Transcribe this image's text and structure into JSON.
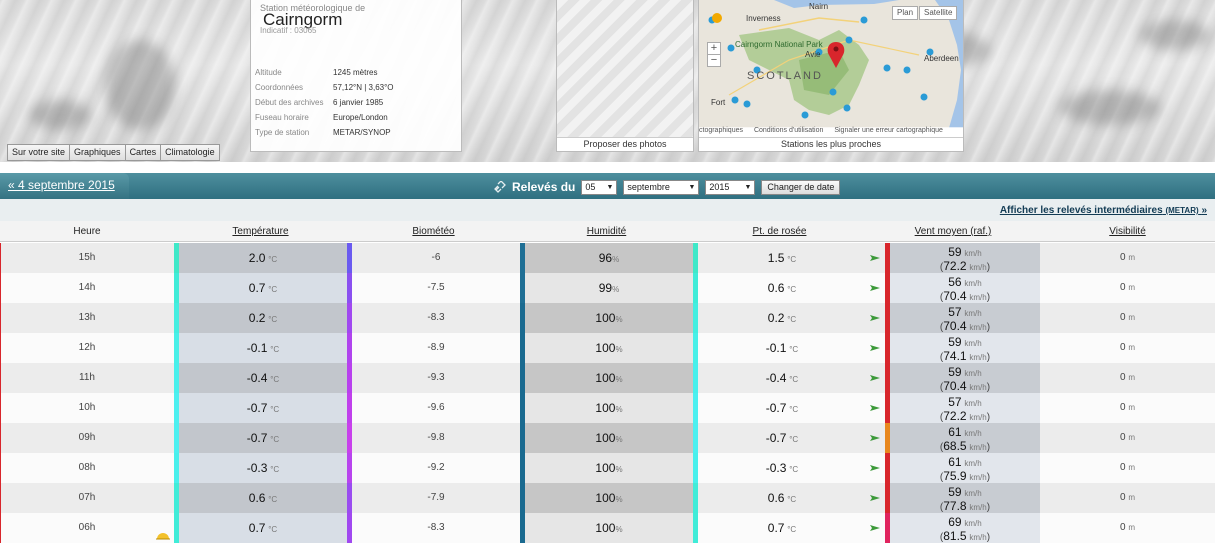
{
  "station": {
    "prefix": "Station météorologique de",
    "name": "Cairngorm",
    "indicatif": "Indicatif : 03065",
    "info": [
      {
        "label": "Altitude",
        "value": "1245 mètres"
      },
      {
        "label": "Coordonnées",
        "value": "57,12°N | 3,63°O"
      },
      {
        "label": "Début des archives",
        "value": "6 janvier 1985"
      },
      {
        "label": "Fuseau horaire",
        "value": "Europe/London"
      },
      {
        "label": "Type de station",
        "value": "METAR/SYNOP"
      }
    ]
  },
  "tabs": [
    "Sur votre site",
    "Graphiques",
    "Cartes",
    "Climatologie"
  ],
  "photos": {
    "caption": "Proposer des photos"
  },
  "map": {
    "caption": "Stations les plus proches",
    "btn_plan": "Plan",
    "btn_sat": "Satellite",
    "labels": [
      "Inverness",
      "Cairngorm National Park",
      "SCOTLAND",
      "Aberdeen",
      "Nairn",
      "Fort",
      "Avie"
    ],
    "attribution": [
      "ctographiques",
      "Conditions d'utilisation",
      "Signaler une erreur cartographique"
    ],
    "zoom_in": "+",
    "zoom_out": "−",
    "colors": {
      "land": "#e9e5dc",
      "park": "#a9c98c",
      "sea": "#a4c4e8",
      "marker": "#2a9bd6",
      "selected": "#d8262c"
    }
  },
  "nav": {
    "prev_day": "« 4 septembre 2015",
    "title": "Relevés du",
    "day": "05",
    "month": "septembre",
    "year": "2015",
    "change": "Changer de date",
    "show_intermediate": "Afficher les relevés intermédiaires",
    "metar_tag": "(METAR)",
    "arrow": "»"
  },
  "columns": [
    "Heure",
    "Température",
    "Biométéo",
    "Humidité",
    "Pt. de rosée",
    "Vent moyen (raf.)",
    "Visibilité"
  ],
  "units": {
    "temp": "°C",
    "hum": "%",
    "wind": "km/h",
    "vis": "m"
  },
  "rows": [
    {
      "hour": "15h",
      "temp": "2.0",
      "bio": "-6",
      "hum": "96",
      "dew": "1.5",
      "wind": "59",
      "gust": "72.2",
      "vis": "0",
      "c_temp": "#3fe8c8",
      "c_bio": "#6a5af0",
      "c_hum": "#1f6f95",
      "c_dew": "#3fe8c8",
      "c_wind": "#d8262c"
    },
    {
      "hour": "14h",
      "temp": "0.7",
      "bio": "-7.5",
      "hum": "99",
      "dew": "0.6",
      "wind": "56",
      "gust": "70.4",
      "vis": "0",
      "c_temp": "#40ecd8",
      "c_bio": "#8a50f0",
      "c_hum": "#1f6f95",
      "c_dew": "#40ecd8",
      "c_wind": "#d8262c"
    },
    {
      "hour": "13h",
      "temp": "0.2",
      "bio": "-8.3",
      "hum": "100",
      "dew": "0.2",
      "wind": "57",
      "gust": "70.4",
      "vis": "0",
      "c_temp": "#44eee0",
      "c_bio": "#a048f0",
      "c_hum": "#1a6a90",
      "c_dew": "#44eee0",
      "c_wind": "#d8262c"
    },
    {
      "hour": "12h",
      "temp": "-0.1",
      "bio": "-8.9",
      "hum": "100",
      "dew": "-0.1",
      "wind": "59",
      "gust": "74.1",
      "vis": "0",
      "c_temp": "#48f0e8",
      "c_bio": "#b044ee",
      "c_hum": "#1a6a90",
      "c_dew": "#48f0e8",
      "c_wind": "#d8262c"
    },
    {
      "hour": "11h",
      "temp": "-0.4",
      "bio": "-9.3",
      "hum": "100",
      "dew": "-0.4",
      "wind": "59",
      "gust": "70.4",
      "vis": "0",
      "c_temp": "#48f0ec",
      "c_bio": "#b840ee",
      "c_hum": "#1a6a90",
      "c_dew": "#48f0ec",
      "c_wind": "#d8262c"
    },
    {
      "hour": "10h",
      "temp": "-0.7",
      "bio": "-9.6",
      "hum": "100",
      "dew": "-0.7",
      "wind": "57",
      "gust": "72.2",
      "vis": "0",
      "c_temp": "#4cf0f0",
      "c_bio": "#c040ec",
      "c_hum": "#1a6a90",
      "c_dew": "#4cf0f0",
      "c_wind": "#d8262c"
    },
    {
      "hour": "09h",
      "temp": "-0.7",
      "bio": "-9.8",
      "hum": "100",
      "dew": "-0.7",
      "wind": "61",
      "gust": "68.5",
      "vis": "0",
      "c_temp": "#4cf0f0",
      "c_bio": "#c840ec",
      "c_hum": "#1a6a90",
      "c_dew": "#4cf0f0",
      "c_wind": "#e8871e"
    },
    {
      "hour": "08h",
      "temp": "-0.3",
      "bio": "-9.2",
      "hum": "100",
      "dew": "-0.3",
      "wind": "61",
      "gust": "75.9",
      "vis": "0",
      "c_temp": "#48f0ec",
      "c_bio": "#b844ee",
      "c_hum": "#1a6a90",
      "c_dew": "#48f0ec",
      "c_wind": "#d8262c"
    },
    {
      "hour": "07h",
      "temp": "0.6",
      "bio": "-7.9",
      "hum": "100",
      "dew": "0.6",
      "wind": "59",
      "gust": "77.8",
      "vis": "0",
      "c_temp": "#40ecd8",
      "c_bio": "#9a4cf0",
      "c_hum": "#1a6a90",
      "c_dew": "#40ecd8",
      "c_wind": "#d8262c"
    },
    {
      "hour": "06h",
      "temp": "0.7",
      "bio": "-8.3",
      "hum": "100",
      "dew": "0.7",
      "wind": "69",
      "gust": "81.5",
      "vis": "0",
      "c_temp": "#40ecd8",
      "c_bio": "#a048f0",
      "c_hum": "#1a6a90",
      "c_dew": "#40ecd8",
      "c_wind": "#e0245e"
    }
  ]
}
